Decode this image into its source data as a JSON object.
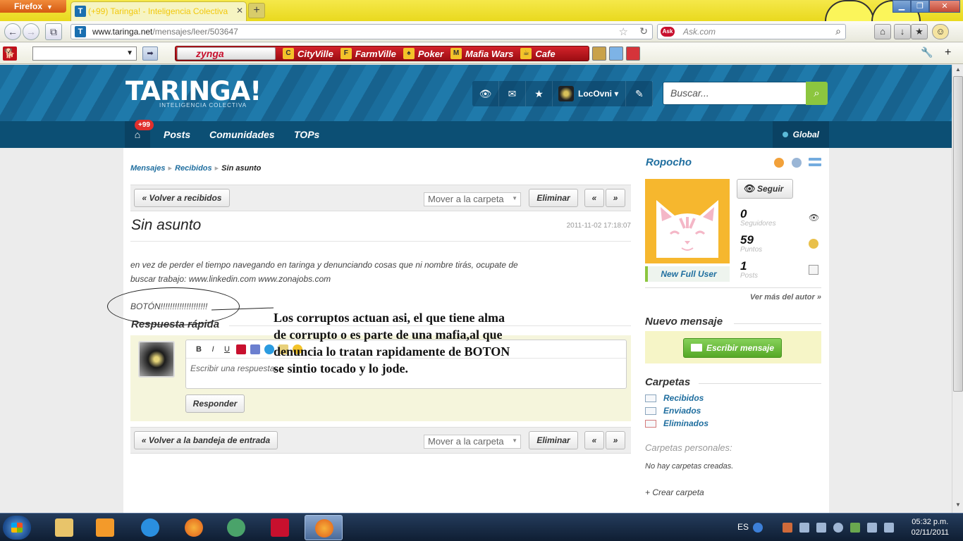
{
  "browser": {
    "menu_label": "Firefox",
    "tab_title": "(+99) Taringa! - Inteligencia Colectiva",
    "tab_icon_letter": "T",
    "new_tab": "+",
    "url_domain": "www.taringa.net",
    "url_path": "/mensajes/leer/503647",
    "search_placeholder": "Ask.com",
    "ask_logo": "Ask"
  },
  "zynga_bar": {
    "logo": "zynga",
    "games": [
      "CityVille",
      "FarmVille",
      "Poker",
      "Mafia Wars",
      "Cafe"
    ]
  },
  "site": {
    "logo": "TARINGA!",
    "tagline": "INTELIGENCIA COLECTIVA",
    "username": "LocOvni",
    "search_placeholder": "Buscar...",
    "nav": {
      "badge": "+99",
      "home_icon": "⌂",
      "items": [
        "Posts",
        "Comunidades",
        "TOPs"
      ],
      "global": "Global"
    }
  },
  "message": {
    "breadcrumb": [
      "Mensajes",
      "Recibidos",
      "Sin asunto"
    ],
    "back_inbox": "« Volver a recibidos",
    "move_folder": "Mover a la carpeta",
    "delete": "Eliminar",
    "prev": "«",
    "next": "»",
    "subject": "Sin asunto",
    "date": "2011-11-02 17:18:07",
    "body_line1": "en vez de perder el tiempo navegando en taringa y denunciando cosas que ni nombre tirás, ocupate de",
    "body_line2": "buscar trabajo: www.linkedin.com www.zonajobs.com",
    "body_line3": "BOTÓN!!!!!!!!!!!!!!!!!!!!",
    "overlay": [
      "Los corruptos actuan asi, el que tiene alma",
      "de corrupto o es parte de una mafia,al que",
      "denuncia lo tratan rapidamente de BOTON",
      "se sintio tocado y lo jode."
    ],
    "reply_title": "Respuesta rápida",
    "reply_placeholder": "Escribir una respuesta...",
    "reply_button": "Responder",
    "back_tray": "« Volver a la bandeja de entrada"
  },
  "sidebar": {
    "author": "Ropocho",
    "follow": "Seguir",
    "stats": [
      {
        "value": "0",
        "label": "Seguidores"
      },
      {
        "value": "59",
        "label": "Puntos"
      },
      {
        "value": "1",
        "label": "Posts"
      }
    ],
    "rank": "New Full User",
    "more_author": "Ver más del autor »",
    "new_message_title": "Nuevo mensaje",
    "write_button": "Escribir mensaje",
    "folders_title": "Carpetas",
    "folders": [
      "Recibidos",
      "Enviados",
      "Eliminados"
    ],
    "personal_title": "Carpetas personales:",
    "no_folders": "No hay carpetas creadas.",
    "create_folder": "+ Crear carpeta"
  },
  "taskbar": {
    "lang": "ES",
    "time": "05:32 p.m.",
    "date": "02/11/2011"
  },
  "colors": {
    "brand_blue": "#1f6e9f",
    "menu_blue": "#0c4f74",
    "search_green": "#8cc63f"
  }
}
